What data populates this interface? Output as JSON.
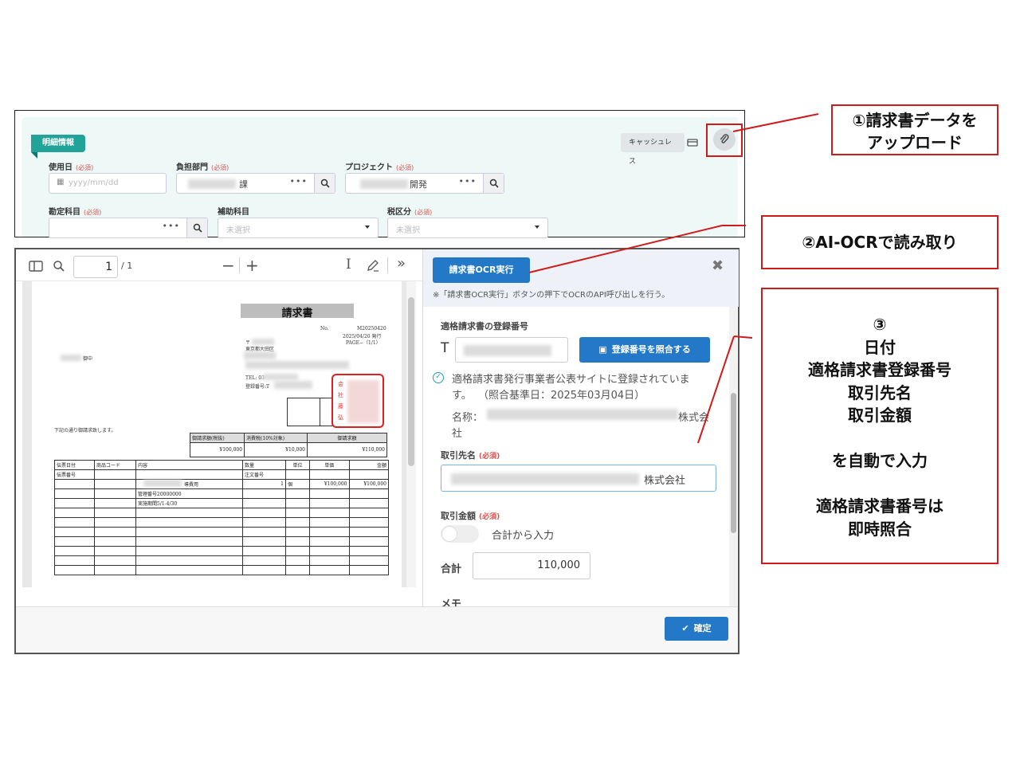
{
  "form": {
    "section_tag": "明細情報",
    "cashless_label": "キャッシュレス",
    "required_mark": "(必須)",
    "fields": {
      "date_label": "使用日",
      "date_placeholder": "yyyy/mm/dd",
      "dept_label": "負担部門",
      "dept_value_suffix": "課",
      "project_label": "プロジェクト",
      "project_value_suffix": "開発",
      "account_label": "勘定科目",
      "sub_account_label": "補助科目",
      "sub_account_placeholder": "未選択",
      "tax_label": "税区分",
      "tax_placeholder": "未選択"
    }
  },
  "pdf_viewer": {
    "page_number": "1",
    "page_total": "/ 1",
    "document": {
      "title": "請求書",
      "no_label": "No.",
      "no_value": "M20250420",
      "issued": "2025/04/20 発行",
      "page": "PAGE−（1/1）",
      "recipient_suffix": "御中",
      "postal": "〒",
      "address": "東京都大田区",
      "tel": "TEL: 03",
      "reg_no": "登録番号:T",
      "intro": "下記の通り御請求致します。",
      "summary_headers": [
        "御請求額(税抜)",
        "消費税(10%対象)",
        "御請求額"
      ],
      "summary_values": [
        "¥100,000",
        "¥10,000",
        "¥110,000"
      ],
      "detail_headers": [
        "伝票日付",
        "商品コード",
        "内容",
        "数量",
        "単位",
        "単価",
        "金額"
      ],
      "detail_headers_2": [
        "伝票番号",
        "",
        "",
        "注文番号",
        "",
        "",
        ""
      ],
      "row1": [
        "",
        "",
        "導費用",
        "1",
        "個",
        "¥100,000",
        "¥100,000"
      ],
      "mgmt_no": "管理番号20000000",
      "period": "実施期間5/1-4/30",
      "seal_text": [
        "会",
        "社",
        "藤",
        "弘"
      ]
    }
  },
  "ocr_panel": {
    "ocr_button": "請求書OCR実行",
    "note": "※「請求書OCR実行」ボタンの押下でOCRのAPI呼び出しを行う。",
    "reg_label": "適格請求書の登録番号",
    "reg_prefix": "T",
    "verify_button": "登録番号を照合する",
    "verified_text_1": "適格請求書発行事業者公表サイトに登録されていま",
    "verified_text_2": "す。  （照合基準日：2025年03月04日）",
    "name_label": "名称：",
    "name_suffix_1": "株式会",
    "name_suffix_2": "社",
    "partner_label": "取引先名",
    "partner_suffix": "株式会社",
    "amount_label": "取引金額",
    "toggle_label": "合計から入力",
    "total_label": "合計",
    "total_value": "110,000",
    "memo_label": "メモ",
    "required_mark": "(必須)"
  },
  "footer": {
    "confirm_label": "確定"
  },
  "annotations": {
    "a1_line1": "①請求書データを",
    "a1_line2": "アップロード",
    "a2": "②AI-OCRで読み取り",
    "a3_lines": [
      "③",
      "日付",
      "適格請求書登録番号",
      "取引先名",
      "取引金額",
      "",
      "を自動で入力",
      "",
      "適格請求書番号は",
      "即時照合"
    ]
  },
  "colors": {
    "accent_teal": "#21a39a",
    "primary_blue": "#2478c8",
    "annotation_red": "#d01b1b"
  }
}
